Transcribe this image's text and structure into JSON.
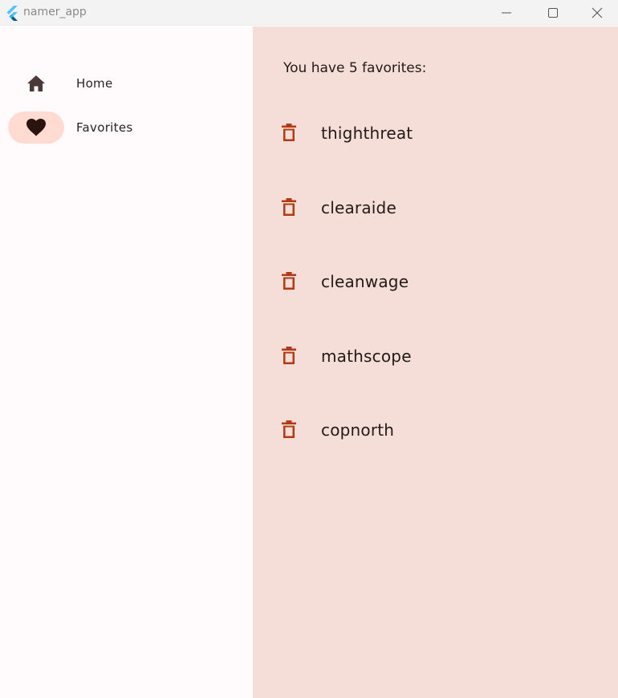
{
  "window": {
    "title": "namer_app",
    "controls": {
      "minimize_icon": "minimize-icon",
      "maximize_icon": "maximize-icon",
      "close_icon": "close-icon"
    }
  },
  "nav": {
    "items": [
      {
        "label": "Home",
        "icon": "home-icon",
        "selected": false
      },
      {
        "label": "Favorites",
        "icon": "heart-icon",
        "selected": true
      }
    ]
  },
  "favorites": {
    "count_text": "You have 5 favorites:",
    "items": [
      {
        "word": "thighthreat"
      },
      {
        "word": "clearaide"
      },
      {
        "word": "cleanwage"
      },
      {
        "word": "mathscope"
      },
      {
        "word": "copnorth"
      }
    ],
    "delete_icon": "delete-icon"
  },
  "colors": {
    "content_bg": "#f4ded7",
    "nav_bg": "#fffbfd",
    "selected_indicator": "#ffdbd1",
    "delete_icon": "#b33a15",
    "text": "#231917"
  }
}
